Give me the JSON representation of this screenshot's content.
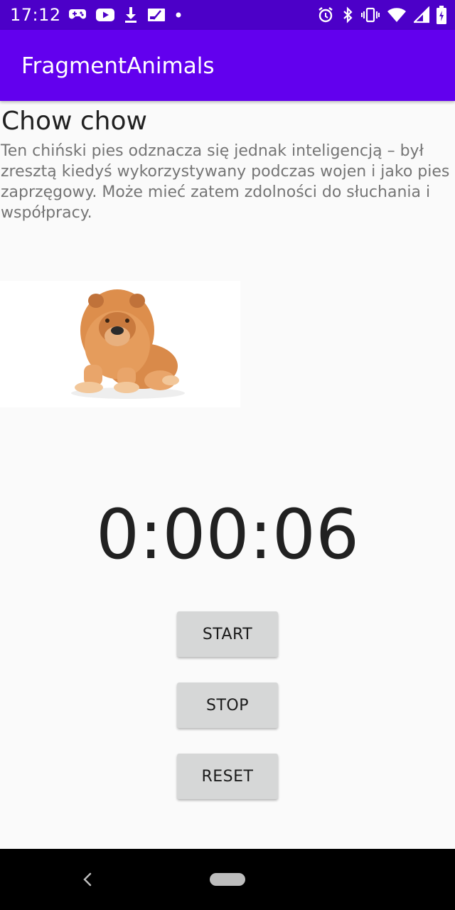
{
  "status_bar": {
    "time": "17:12",
    "left_icons": [
      "game-controller-icon",
      "youtube-icon",
      "download-icon",
      "sim-card-icon",
      "dot-icon"
    ],
    "right_icons": [
      "alarm-icon",
      "bluetooth-icon",
      "vibrate-icon",
      "wifi-icon",
      "signal-icon",
      "battery-charging-icon"
    ],
    "color": "#4c00c8"
  },
  "app_bar": {
    "title": "FragmentAnimals",
    "color": "#6200ee"
  },
  "animal": {
    "name": "Chow chow",
    "description": "Ten chiński pies odznacza się jednak inteligencją – był zresztą kiedyś wykorzystywany podczas wojen i jako pies zaprzęgowy. Może mieć zatem zdolności do słuchania i współpracy.",
    "image_icon": "chow-chow-dog-image"
  },
  "stopwatch": {
    "time": "0:00:06",
    "start_label": "START",
    "stop_label": "STOP",
    "reset_label": "RESET"
  },
  "nav_bar": {
    "icons": [
      "back-icon",
      "home-pill-icon"
    ]
  }
}
